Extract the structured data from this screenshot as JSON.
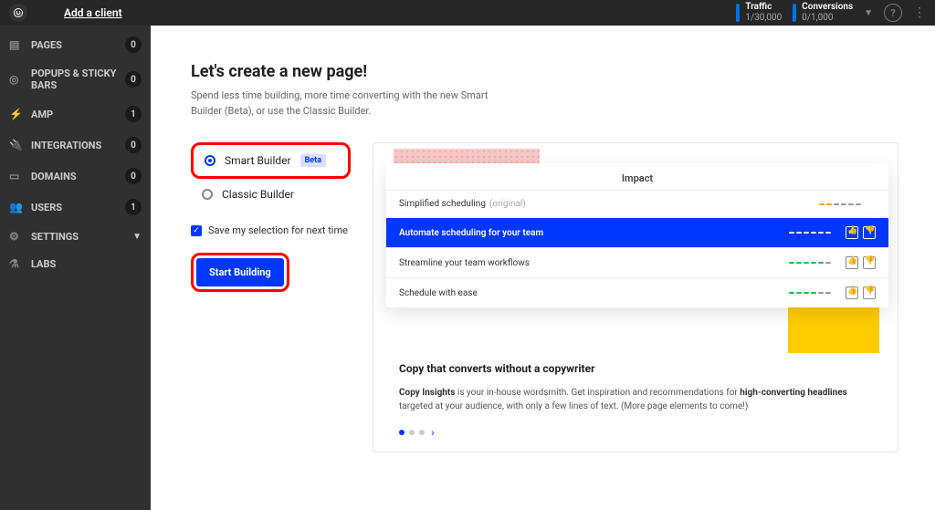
{
  "header": {
    "add_client": "Add a client",
    "traffic_label": "Traffic",
    "traffic_value": "1/30,000",
    "conversions_label": "Conversions",
    "conversions_value": "0/1,000"
  },
  "sidebar": {
    "items": [
      {
        "icon": "pages",
        "label": "PAGES",
        "badge": "0"
      },
      {
        "icon": "popups",
        "label": "POPUPS & STICKY BARS",
        "badge": "0"
      },
      {
        "icon": "amp",
        "label": "AMP",
        "badge": "1"
      },
      {
        "icon": "plug",
        "label": "INTEGRATIONS",
        "badge": "0"
      },
      {
        "icon": "domains",
        "label": "DOMAINS",
        "badge": "0"
      },
      {
        "icon": "users",
        "label": "USERS",
        "badge": "1"
      },
      {
        "icon": "gear",
        "label": "SETTINGS",
        "caret": true
      },
      {
        "icon": "flask",
        "label": "LABS"
      }
    ]
  },
  "main": {
    "heading": "Let's create a new page!",
    "subhead": "Spend less time building, more time converting with the new Smart Builder (Beta), or use the Classic Builder.",
    "options": {
      "smart": "Smart Builder",
      "beta": "Beta",
      "classic": "Classic Builder"
    },
    "save_label": "Save my selection for next time",
    "start_btn": "Start Building"
  },
  "preview": {
    "impact": "Impact",
    "row1": "Simplified scheduling",
    "row1_orig": "(original)",
    "row2": "Automate scheduling for your team",
    "row3": "Streamline your team workflows",
    "row4": "Schedule with ease",
    "title": "Copy that converts without a copywriter",
    "body_bold1": "Copy Insights",
    "body_mid": " is your in-house wordsmith. Get inspiration and recommendations for ",
    "body_bold2": "high-converting headlines",
    "body_end": " targeted at your audience, with only a few lines of text. (More page elements to come!)"
  }
}
